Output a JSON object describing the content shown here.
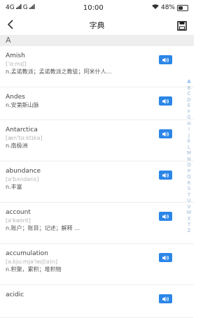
{
  "status_bar": {
    "network": "4G",
    "network2": "G",
    "time": "10:00",
    "battery": "48%",
    "battery_level": 0.48
  },
  "nav": {
    "title": "字典",
    "back_icon": "back-arrow-icon",
    "save_icon": "save-icon"
  },
  "section": {
    "letter": "A"
  },
  "entries": [
    {
      "word": "Amish",
      "phonetic": "[ˈɑːmɪʃ]",
      "meaning": "n.孟诺教派；孟诺教派之教徒；阿米什人…"
    },
    {
      "word": "Andes",
      "phonetic": "",
      "meaning": "n.安第斯山脉"
    },
    {
      "word": "Antarctica",
      "phonetic": "[æn'tɑːktɪkə]",
      "meaning": "n.南极洲"
    },
    {
      "word": "abundance",
      "phonetic": "[ə'bʌndəns]",
      "meaning": "n.丰富"
    },
    {
      "word": "account",
      "phonetic": "[ə'kaʊnt]",
      "meaning": "n.账户；账目；记述；解释 …"
    },
    {
      "word": "accumulation",
      "phonetic": "[əˌkjuːmjə'leɪʃ(ə)n]",
      "meaning": "n.积聚，累积；堆积物"
    },
    {
      "word": "acidic",
      "phonetic": "",
      "meaning": ""
    }
  ],
  "alphabet": [
    "A",
    "B",
    "C",
    "D",
    "E",
    "F",
    "G",
    "H",
    "I",
    "J",
    "K",
    "L",
    "M",
    "N",
    "O",
    "P",
    "Q",
    "R",
    "S",
    "T",
    "U",
    "V",
    "W",
    "X",
    "Y",
    "Z"
  ],
  "colors": {
    "accent": "#2b86e8",
    "section_bg": "#eeeeee",
    "phonetic": "#b5b5b5"
  }
}
